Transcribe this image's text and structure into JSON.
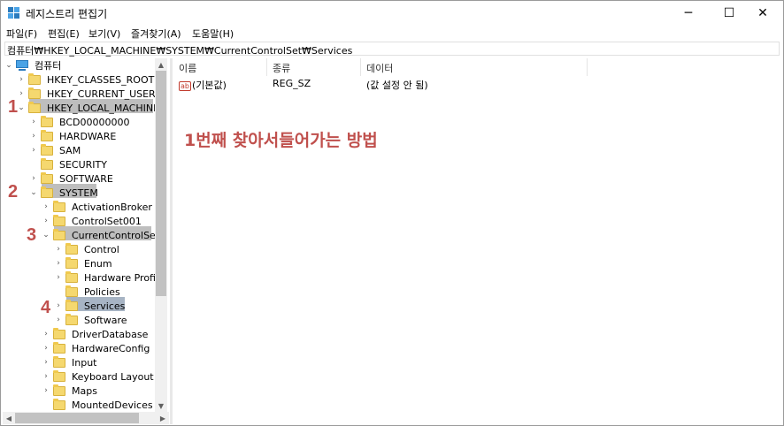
{
  "window": {
    "title": "레지스트리 편집기",
    "minimize_icon": "─",
    "maximize_icon": "☐",
    "close_icon": "✕"
  },
  "menu": [
    "파일(F)",
    "편집(E)",
    "보기(V)",
    "즐겨찾기(A)",
    "도움말(H)"
  ],
  "address": "컴퓨터₩HKEY_LOCAL_MACHINE₩SYSTEM₩CurrentControlSet₩Services",
  "tree": {
    "root": "컴퓨터",
    "items": [
      {
        "label": "HKEY_CLASSES_ROOT",
        "exp": "›"
      },
      {
        "label": "HKEY_CURRENT_USER",
        "exp": "›"
      },
      {
        "label": "HKEY_LOCAL_MACHINE",
        "exp": "⌄"
      },
      {
        "label": "BCD00000000",
        "exp": "›"
      },
      {
        "label": "HARDWARE",
        "exp": "›"
      },
      {
        "label": "SAM",
        "exp": "›"
      },
      {
        "label": "SECURITY",
        "exp": ""
      },
      {
        "label": "SOFTWARE",
        "exp": "›"
      },
      {
        "label": "SYSTEM",
        "exp": "⌄"
      },
      {
        "label": "ActivationBroker",
        "exp": "›"
      },
      {
        "label": "ControlSet001",
        "exp": "›"
      },
      {
        "label": "CurrentControlSet",
        "exp": "⌄"
      },
      {
        "label": "Control",
        "exp": "›"
      },
      {
        "label": "Enum",
        "exp": "›"
      },
      {
        "label": "Hardware Profile",
        "exp": "›"
      },
      {
        "label": "Policies",
        "exp": ""
      },
      {
        "label": "Services",
        "exp": "›"
      },
      {
        "label": "Software",
        "exp": "›"
      },
      {
        "label": "DriverDatabase",
        "exp": "›"
      },
      {
        "label": "HardwareConfig",
        "exp": "›"
      },
      {
        "label": "Input",
        "exp": "›"
      },
      {
        "label": "Keyboard Layout",
        "exp": "›"
      },
      {
        "label": "Maps",
        "exp": "›"
      },
      {
        "label": "MountedDevices",
        "exp": ""
      }
    ]
  },
  "columns": [
    "이름",
    "종류",
    "데이터"
  ],
  "values": [
    {
      "icon": "ab",
      "name": "(기본값)",
      "type": "REG_SZ",
      "data": "(값 설정 안 됨)"
    }
  ],
  "annotation": "1번째 찾아서들어가는 방법",
  "steps": [
    "1",
    "2",
    "3",
    "4"
  ],
  "colors": {
    "annotation": "#c0504d",
    "highlight": "#a8a8a8"
  }
}
